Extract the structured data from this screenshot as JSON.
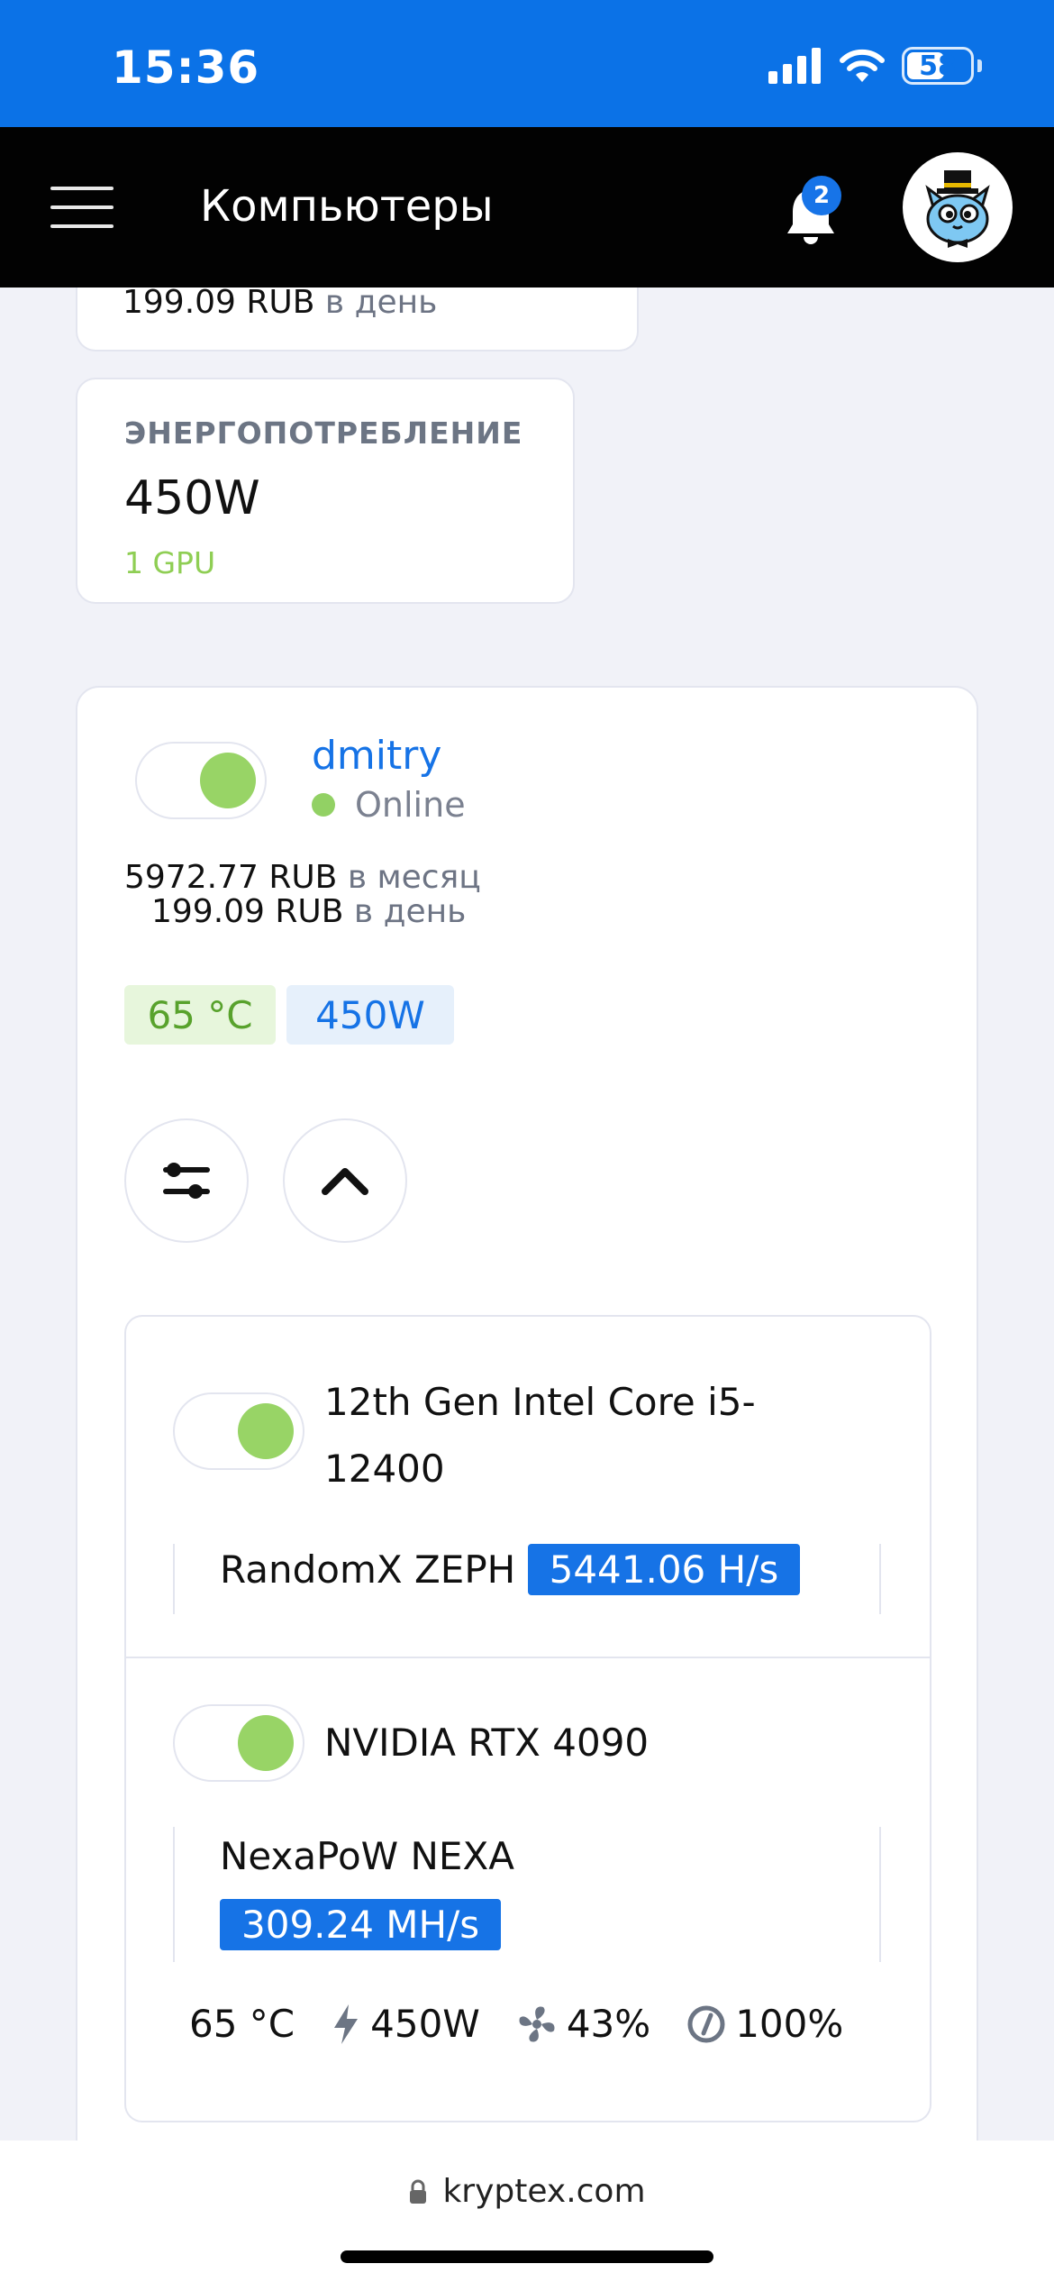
{
  "status_bar": {
    "time": "15:36",
    "battery": "58"
  },
  "app_bar": {
    "title": "Компьютеры",
    "notification_count": "2"
  },
  "top_card": {
    "value": "199.09 RUB",
    "unit": "в день"
  },
  "energy_card": {
    "label": "ЭНЕРГОПОТРЕБЛЕНИЕ",
    "value": "450W",
    "sub": "1 GPU"
  },
  "machine": {
    "name": "dmitry",
    "status": "Online",
    "monthly_value": "5972.77 RUB",
    "monthly_unit": "в месяц",
    "daily_value": "199.09 RUB",
    "daily_unit": "в день",
    "temp_tag": "65 °C",
    "power_tag": "450W",
    "devices": [
      {
        "name_line1": "12th Gen Intel Core i5-",
        "name_line2": "12400",
        "algo": "RandomX ZEPH",
        "hashrate": "5441.06 H/s"
      },
      {
        "name": "NVIDIA RTX 4090",
        "algo": "NexaPoW NEXA",
        "hashrate": "309.24 MH/s",
        "stats": {
          "temp": "65 °C",
          "power": "450W",
          "fan": "43%",
          "load": "100%"
        }
      }
    ]
  },
  "browser": {
    "url": "kryptex.com"
  },
  "colors": {
    "primary": "#1673e6",
    "status_bar": "#0b72e7",
    "online": "#92d164",
    "app_bar": "#020202"
  }
}
